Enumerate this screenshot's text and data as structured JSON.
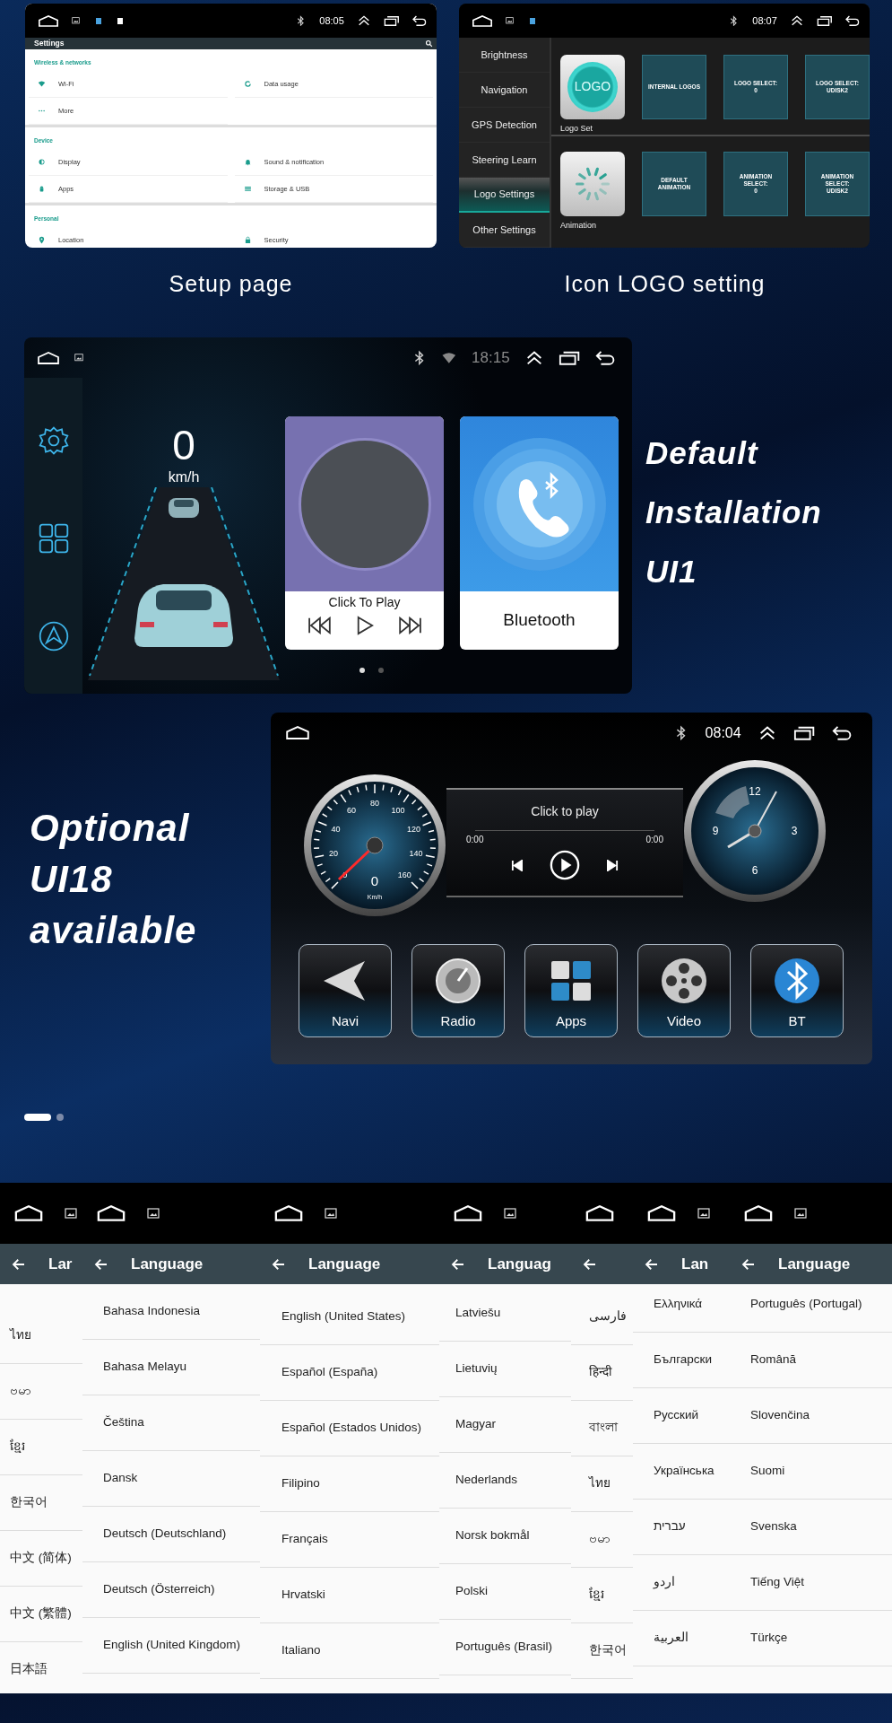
{
  "setup_screen": {
    "status_bar": {
      "time": "08:05"
    },
    "title": "Settings",
    "sections": [
      {
        "heading": "Wireless & networks",
        "items": [
          "Wi-Fi",
          "Data usage",
          "More"
        ]
      },
      {
        "heading": "Device",
        "items": [
          "Display",
          "Sound & notification",
          "Apps",
          "Storage & USB"
        ]
      },
      {
        "heading": "Personal",
        "items": [
          "Location",
          "Security"
        ]
      }
    ]
  },
  "logo_screen": {
    "status_bar": {
      "time": "08:07"
    },
    "menu": [
      {
        "label": "Brightness",
        "selected": false
      },
      {
        "label": "Navigation",
        "selected": false
      },
      {
        "label": "GPS Detection",
        "selected": false
      },
      {
        "label": "Steering Learn",
        "selected": false
      },
      {
        "label": "Logo Settings",
        "selected": true
      },
      {
        "label": "Other Settings",
        "selected": false
      }
    ],
    "rows": [
      {
        "kind": "logo",
        "badge": "LOGO",
        "label": "Logo Set",
        "tiles": [
          "INTERNAL LOGOS",
          "LOGO SELECT:\n0",
          "LOGO SELECT:\nUDISK2"
        ]
      },
      {
        "kind": "animation",
        "label": "Animation",
        "tiles": [
          "DEFAULT\nANIMATION",
          "ANIMATION\nSELECT:\n0",
          "ANIMATION\nSELECT:\nUDISK2"
        ]
      }
    ]
  },
  "captions": [
    "Setup page",
    "Icon LOGO setting"
  ],
  "ui11_screen": {
    "status_bar": {
      "time": "18:15"
    },
    "speed": "0",
    "unit": "km/h",
    "music_card": {
      "title": "Click To Play"
    },
    "bluetooth_card": {
      "title": "Bluetooth"
    },
    "page_dots": [
      {
        "selected": true
      },
      {
        "selected": false
      }
    ]
  },
  "ui11_heading": "Default\nInstallation\nUI1",
  "ui18_heading": "Optional\nUI18\navailable",
  "ui18_screen": {
    "status_bar": {
      "time": "08:04"
    },
    "speedometer": {
      "scale": [
        "0",
        "20",
        "40",
        "60",
        "80",
        "100",
        "120",
        "140",
        "160"
      ],
      "reading": "0",
      "unit": "Km/h"
    },
    "clock": {
      "numerals": [
        "12",
        "3",
        "6",
        "9"
      ]
    },
    "player": {
      "title": "Click to play",
      "elapsed": "0:00",
      "total": "0:00",
      "level": 0
    },
    "apps": [
      "Navi",
      "Radio",
      "Apps",
      "Video",
      "BT"
    ]
  },
  "carousel_dots": [
    {
      "selected": true
    },
    {
      "selected": false
    }
  ],
  "language_screens": [
    {
      "title": "Lar",
      "items": [
        "ไทย",
        "ဗမာ",
        "ខ្មែរ",
        "한국어",
        "中文 (简体)",
        "中文 (繁體)",
        "日本語"
      ]
    },
    {
      "title": "Language",
      "items": [
        "Bahasa Indonesia",
        "Bahasa Melayu",
        "Čeština",
        "Dansk",
        "Deutsch (Deutschland)",
        "Deutsch (Österreich)",
        "English (United Kingdom)"
      ]
    },
    {
      "title": "Language",
      "items": [
        "English (United States)",
        "Español (España)",
        "Español (Estados Unidos)",
        "Filipino",
        "Français",
        "Hrvatski",
        "Italiano"
      ]
    },
    {
      "title": "Languag",
      "items": [
        "Latviešu",
        "Lietuvių",
        "Magyar",
        "Nederlands",
        "Norsk bokmål",
        "Polski",
        "Português (Brasil)"
      ]
    },
    {
      "items": [
        "فارسی",
        "हिन्दी",
        "বাংলা",
        "ไทย",
        "ဗမာ",
        "ខ្មែរ",
        "한국어"
      ]
    },
    {
      "title": "Lan",
      "items": [
        "Ελληνικά",
        "Български",
        "Русский",
        "Українська",
        "עברית",
        "اردو",
        "العربية"
      ]
    },
    {
      "title": "Language",
      "items": [
        "Português (Portugal)",
        "Română",
        "Slovenčina",
        "Suomi",
        "Svenska",
        "Tiếng Việt",
        "Türkçe"
      ]
    }
  ]
}
